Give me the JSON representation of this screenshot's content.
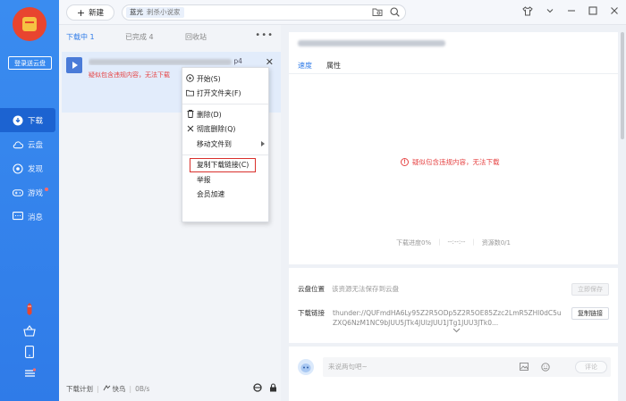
{
  "sidebar": {
    "login_button": "登录送云盘",
    "nav": [
      {
        "label": "下载",
        "icon": "download-icon",
        "active": true
      },
      {
        "label": "云盘",
        "icon": "cloud-icon"
      },
      {
        "label": "发现",
        "icon": "discover-icon"
      },
      {
        "label": "游戏",
        "icon": "gamepad-icon",
        "badge": true
      },
      {
        "label": "消息",
        "icon": "message-icon"
      }
    ]
  },
  "topbar": {
    "new_button": "新建",
    "search_tag": "蓝光",
    "search_tag_sub": "刺杀小说家"
  },
  "list": {
    "tabs": [
      {
        "label": "下载中",
        "count": "1"
      },
      {
        "label": "已完成",
        "count": "4"
      },
      {
        "label": "回收站",
        "count": ""
      }
    ],
    "task": {
      "name_suffix": "p4",
      "warning": "疑似包含违规内容，无法下载"
    },
    "status": {
      "plan": "下载计划",
      "speed_mode": "快鸟",
      "speed": "0B/s"
    }
  },
  "context_menu": {
    "items": [
      {
        "label": "开始(S)",
        "icon": "play-circle-icon"
      },
      {
        "label": "打开文件夹(F)",
        "icon": "folder-icon"
      },
      {
        "label": "删除(D)",
        "icon": "trash-icon"
      },
      {
        "label": "彻底删除(Q)",
        "icon": "x-icon"
      },
      {
        "label": "移动文件到",
        "submenu": true
      },
      {
        "label": "复制下载链接(C)",
        "highlight": true
      },
      {
        "label": "举报"
      },
      {
        "label": "会员加速"
      }
    ]
  },
  "details": {
    "tabs": [
      "速度",
      "属性"
    ],
    "warning": "疑似包含违规内容，无法下载",
    "progress_label": "下载进度0%",
    "time_label": "--:--:--",
    "resources_label": "资源数0/1"
  },
  "cloud": {
    "location_label": "云盘位置",
    "location_value": "该资源无法保存到云盘",
    "save_button": "立即保存",
    "link_label": "下载链接",
    "link_value": "thunder://QUFmdHA6Ly95Z2R5ODp5Z2R5OE85Zzc2LmR5ZHl0dC5uZXQ6NzM1NC9bJUU5JTk4JUIzJUU1JTg1JUU3JTk0...",
    "copy_button": "复制链接"
  },
  "comment": {
    "placeholder": "来说两句吧~",
    "submit_button": "评论"
  }
}
